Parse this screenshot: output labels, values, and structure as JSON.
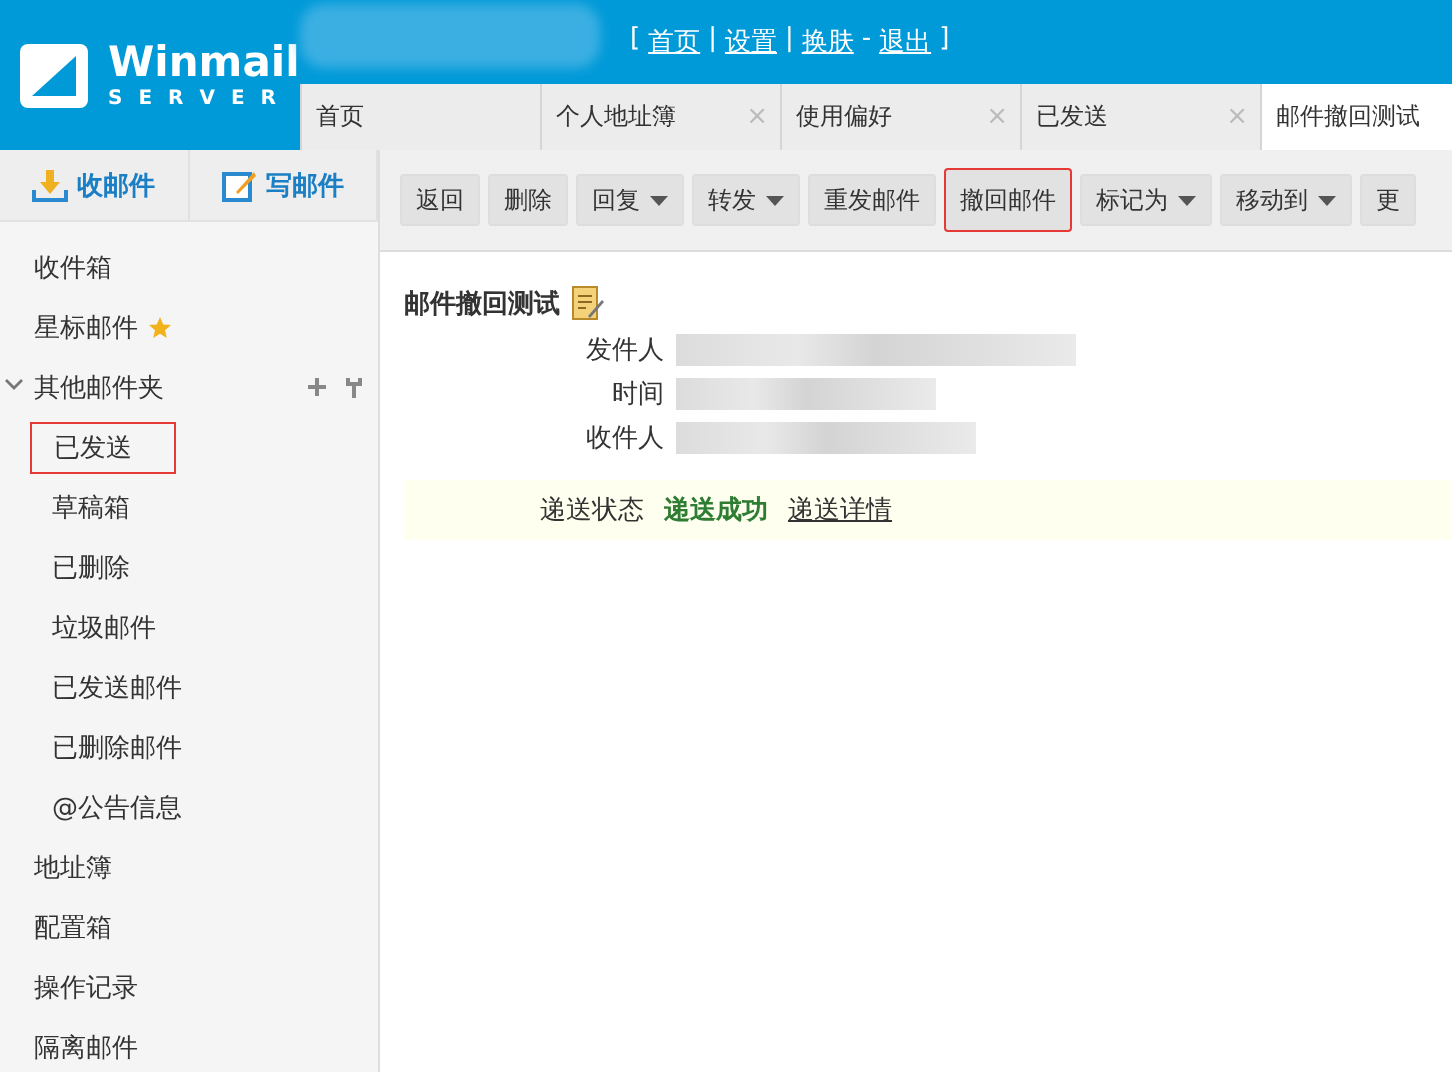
{
  "header": {
    "logo_name": "Winmail",
    "logo_sub": "SERVER",
    "links": [
      {
        "kind": "bracket",
        "text": "["
      },
      {
        "kind": "link",
        "text": "首页"
      },
      {
        "kind": "sep",
        "text": "|"
      },
      {
        "kind": "link",
        "text": "设置"
      },
      {
        "kind": "sep",
        "text": "|"
      },
      {
        "kind": "link",
        "text": "换肤"
      },
      {
        "kind": "sep",
        "text": "-"
      },
      {
        "kind": "link",
        "text": "退出"
      },
      {
        "kind": "bracket",
        "text": "]"
      }
    ]
  },
  "tabs": [
    {
      "label": "首页",
      "selected": false
    },
    {
      "label": "个人地址簿",
      "selected": false,
      "close": "×"
    },
    {
      "label": "使用偏好",
      "selected": false,
      "close": "×"
    },
    {
      "label": "已发送",
      "selected": false,
      "close": "×"
    },
    {
      "label": "邮件撤回测试",
      "selected": true
    }
  ],
  "sidebar": {
    "actions": [
      {
        "kind": "receive",
        "label": "收邮件"
      },
      {
        "kind": "compose",
        "label": "写邮件"
      }
    ],
    "items": [
      {
        "label": "收件箱",
        "selected": false
      },
      {
        "label": "星标邮件",
        "selected": false,
        "starred": true
      },
      {
        "label": "其他邮件夹",
        "selected": false,
        "expanded": true,
        "tools": true,
        "children": [
          {
            "label": "已发送",
            "selected": true
          },
          {
            "label": "草稿箱",
            "selected": false
          },
          {
            "label": "已删除",
            "selected": false
          },
          {
            "label": "垃圾邮件",
            "selected": false
          },
          {
            "label": "已发送邮件",
            "selected": false
          },
          {
            "label": "已删除邮件",
            "selected": false
          },
          {
            "label": "@公告信息",
            "selected": false
          }
        ]
      },
      {
        "label": "地址簿",
        "selected": false
      },
      {
        "label": "配置箱",
        "selected": false
      },
      {
        "label": "操作记录",
        "selected": false
      },
      {
        "label": "隔离邮件",
        "selected": false
      }
    ]
  },
  "toolbar": [
    {
      "label": "返回",
      "dropdown": false,
      "highlighted": false
    },
    {
      "label": "删除",
      "dropdown": false,
      "highlighted": false
    },
    {
      "label": "回复",
      "dropdown": true,
      "highlighted": false
    },
    {
      "label": "转发",
      "dropdown": true,
      "highlighted": false
    },
    {
      "label": "重发邮件",
      "dropdown": false,
      "highlighted": false
    },
    {
      "label": "撤回邮件",
      "dropdown": false,
      "highlighted": true
    },
    {
      "label": "标记为",
      "dropdown": true,
      "highlighted": false
    },
    {
      "label": "移动到",
      "dropdown": true,
      "highlighted": false
    },
    {
      "label": "更",
      "dropdown": false,
      "highlighted": false
    }
  ],
  "message": {
    "subject": "邮件撤回测试",
    "fields": [
      {
        "label": "发件人"
      },
      {
        "label": "时间"
      },
      {
        "label": "收件人"
      }
    ],
    "status": {
      "label": "递送状态",
      "value": "递送成功",
      "link": "递送详情"
    }
  }
}
